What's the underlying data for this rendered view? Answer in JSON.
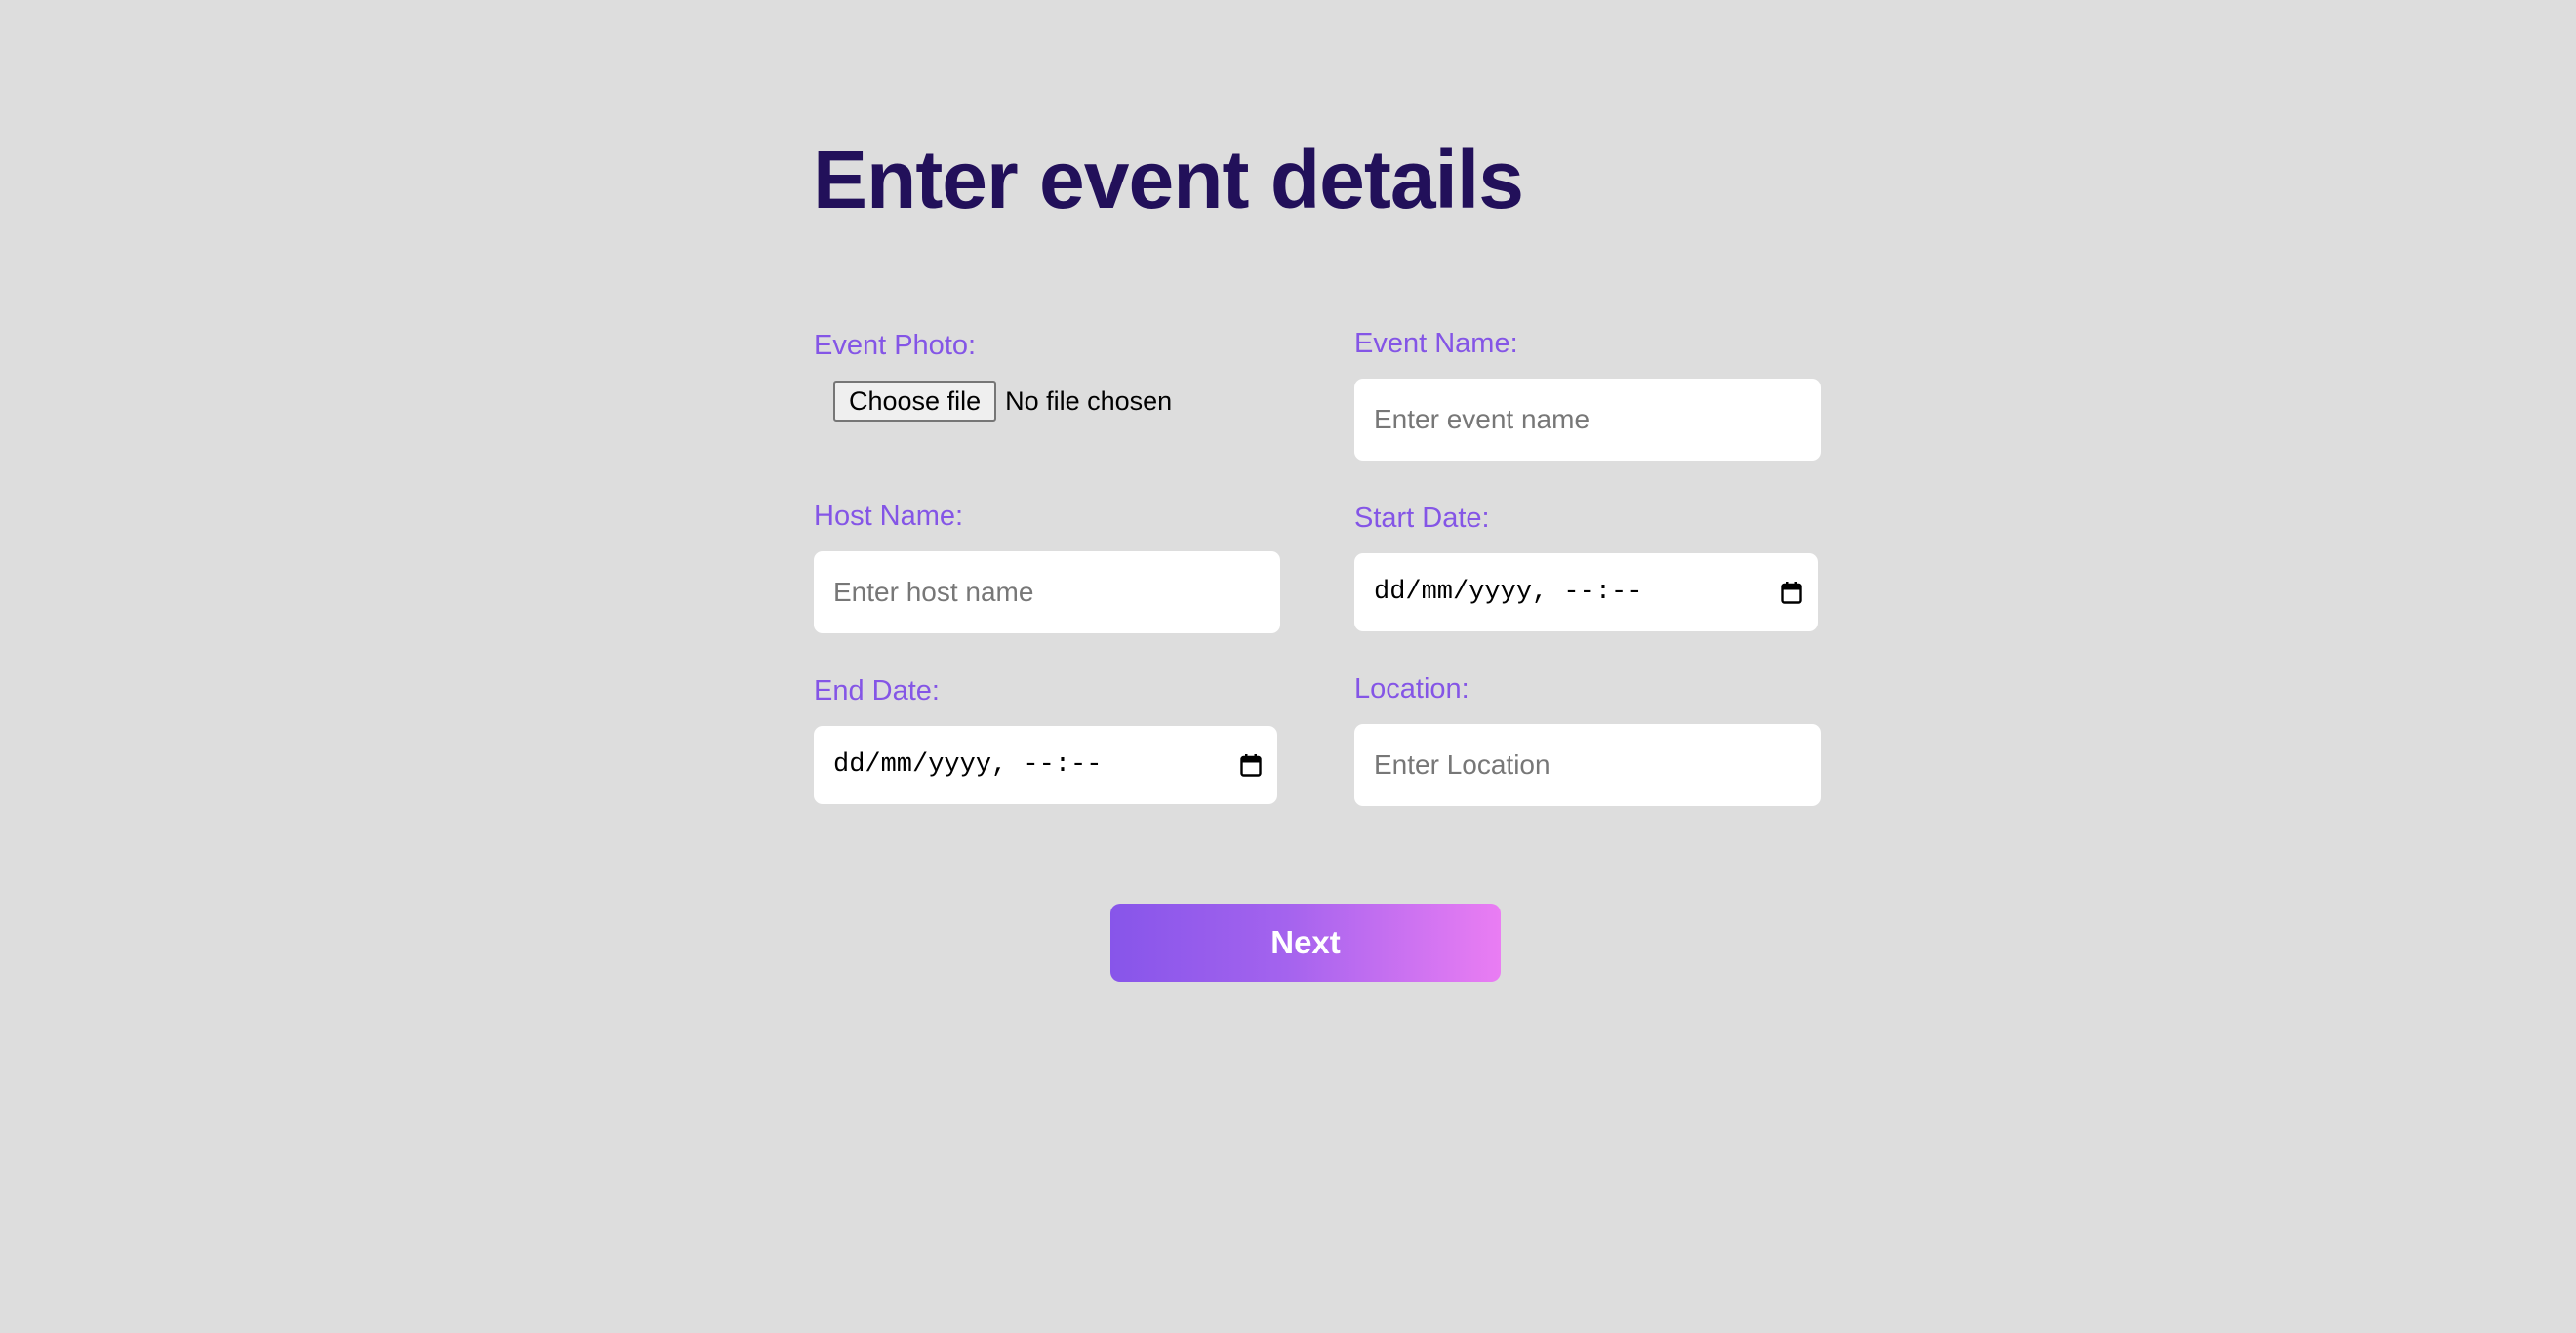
{
  "page": {
    "title": "Enter event details"
  },
  "form": {
    "event_photo": {
      "label": "Event Photo:",
      "button_label": "Choose file",
      "status": "No file chosen"
    },
    "event_name": {
      "label": "Event Name:",
      "placeholder": "Enter event name"
    },
    "host_name": {
      "label": "Host Name:",
      "placeholder": "Enter host name"
    },
    "start_date": {
      "label": "Start Date:",
      "format_text": "dd/mm/yyyy, --:--",
      "icon": "calendar-icon"
    },
    "end_date": {
      "label": "End Date:",
      "format_text": "dd/mm/yyyy, --:--",
      "icon": "calendar-icon"
    },
    "location": {
      "label": "Location:",
      "placeholder": "Enter Location"
    }
  },
  "actions": {
    "next_label": "Next"
  },
  "colors": {
    "background": "#dddddd",
    "title": "#22105a",
    "label": "#8455e6",
    "button_gradient_start": "#8755ea",
    "button_gradient_end": "#ea7df3"
  }
}
